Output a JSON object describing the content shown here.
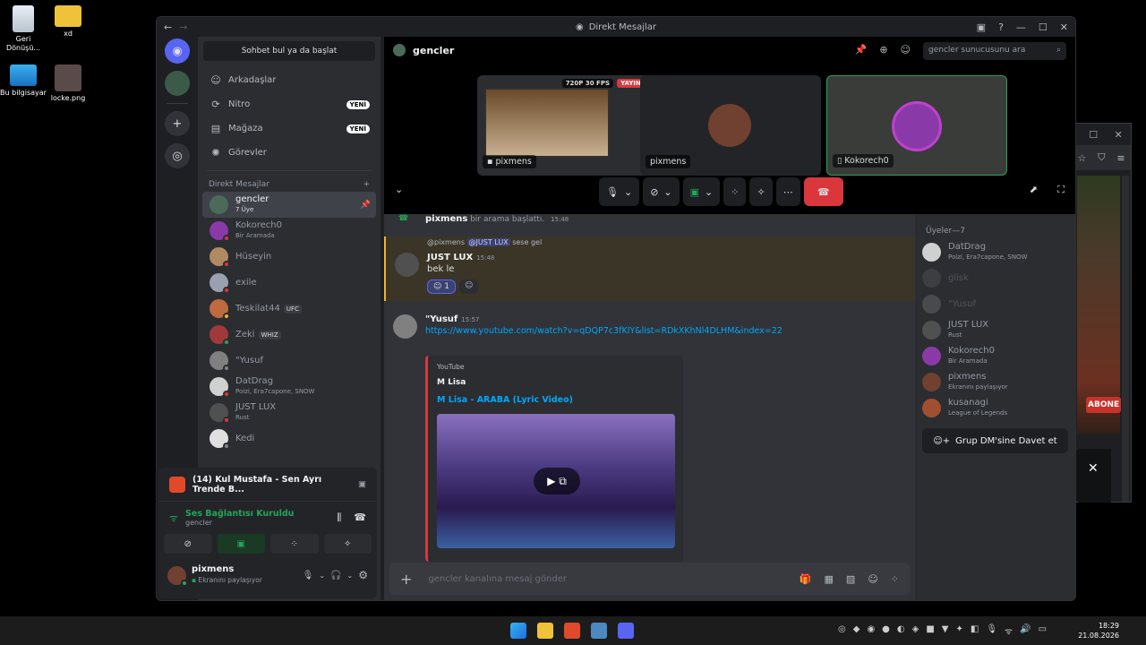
{
  "desktop": {
    "icons": [
      {
        "label": "Geri Dönüşü...",
        "icon": "recycle-bin-icon"
      },
      {
        "label": "xd",
        "icon": "folder-icon"
      },
      {
        "label": "Bu bilgisayar",
        "icon": "computer-icon"
      },
      {
        "label": "locke.png",
        "icon": "image-file-icon"
      }
    ]
  },
  "window": {
    "title": "Direkt Mesajlar"
  },
  "sidebar": {
    "search_label": "Sohbet bul ya da başlat",
    "nav": [
      {
        "label": "Arkadaşlar",
        "badge": ""
      },
      {
        "label": "Nitro",
        "badge": "YENİ"
      },
      {
        "label": "Mağaza",
        "badge": "YENİ"
      },
      {
        "label": "Görevler",
        "badge": ""
      }
    ],
    "dm_header": "Direkt Mesajlar",
    "dms": [
      {
        "name": "gencler",
        "sub": "7 Üye",
        "tag": "",
        "color": "#4a6b5a",
        "status": ""
      },
      {
        "name": "Kokorech0",
        "sub": "Bir Aramada",
        "tag": "",
        "color": "#8a3aa8",
        "status": "#da373c"
      },
      {
        "name": "Hüseyin",
        "sub": "",
        "tag": "",
        "color": "#b08a60",
        "status": "#da373c"
      },
      {
        "name": "exile",
        "sub": "",
        "tag": "",
        "color": "#9aa0b0",
        "status": "#da373c"
      },
      {
        "name": "Teskilat44",
        "sub": "",
        "tag": "UFC",
        "color": "#c06a40",
        "status": "#f0b232"
      },
      {
        "name": "Zeki",
        "sub": "",
        "tag": "WHIZ",
        "color": "#a03a3a",
        "status": "#23a55a"
      },
      {
        "name": "\"Yusuf",
        "sub": "",
        "tag": "",
        "color": "#808080",
        "status": "#80848e"
      },
      {
        "name": "DatDrag",
        "sub": "Poizi, Era7capone, SNOW",
        "tag": "",
        "color": "#d0d0d0",
        "status": "#da373c"
      },
      {
        "name": "JUST LUX",
        "sub": "Rust",
        "tag": "",
        "color": "#505050",
        "status": "#da373c"
      },
      {
        "name": "Kedi",
        "sub": "",
        "tag": "",
        "color": "#e0e0e0",
        "status": "#80848e"
      }
    ]
  },
  "panel": {
    "media_title": "(14) Kul Mustafa - Sen Ayrı Trende B...",
    "voice_status": "Ses Bağlantısı Kuruldu",
    "voice_channel": "gencler",
    "user_name": "pixmens",
    "user_status": "Ekranını paylaşıyor"
  },
  "call": {
    "channel": "gencler",
    "search_placeholder": "gencler sunucusunu ara",
    "tiles": [
      {
        "label": "pixmens",
        "fps": "720P 30 FPS",
        "live": "YAYINDA"
      },
      {
        "label": "pixmens",
        "fps": "",
        "live": ""
      },
      {
        "label": "Kokorech0",
        "fps": "",
        "live": ""
      }
    ]
  },
  "chat": {
    "system_msg_name": "pixmens",
    "system_msg_text": "bir arama başlattı.",
    "system_msg_time": "15:48",
    "reply_author": "@pixmens",
    "reply_mention": "@JUST LUX",
    "reply_text": "sese gel",
    "msg1_name": "JUST LUX",
    "msg1_time": "15:48",
    "msg1_text": "bek le",
    "reaction_count": "1",
    "msg2_name": "\"Yusuf",
    "msg2_time": "15:57",
    "msg2_link": "https://www.youtube.com/watch?v=qDQP7c3fKlY&list=RDkXKhNl4DLHM&index=22",
    "embed_provider": "YouTube",
    "embed_author": "M Lisa",
    "embed_title": "M Lisa - ARABA (Lyric Video)",
    "composer_placeholder": "gencler kanalına mesaj gönder"
  },
  "members": {
    "header": "Üyeler—7",
    "list": [
      {
        "name": "DatDrag",
        "sub": "Poizi, Era7capone, SNOW",
        "dim": false,
        "color": "#d0d0d0"
      },
      {
        "name": "glisk",
        "sub": "",
        "dim": true,
        "color": "#606060"
      },
      {
        "name": "\"Yusuf",
        "sub": "",
        "dim": true,
        "color": "#808080"
      },
      {
        "name": "JUST LUX",
        "sub": "Rust",
        "dim": false,
        "color": "#505050"
      },
      {
        "name": "Kokorech0",
        "sub": "Bir Aramada",
        "dim": false,
        "color": "#8a3aa8"
      },
      {
        "name": "pixmens",
        "sub": "Ekranını paylaşıyor",
        "dim": false,
        "color": "#704030"
      },
      {
        "name": "kusanagi",
        "sub": "League of Legends",
        "dim": false,
        "color": "#a05030"
      }
    ],
    "invite_label": "Grup DM'sine Davet et"
  },
  "background_window": {
    "badge": "ABONE"
  },
  "taskbar": {
    "time": "18:29",
    "date": "21.08.2026"
  },
  "colors": {
    "accent": "#5865f2",
    "green": "#23a55a",
    "red": "#da373c",
    "link": "#00a8fc"
  }
}
